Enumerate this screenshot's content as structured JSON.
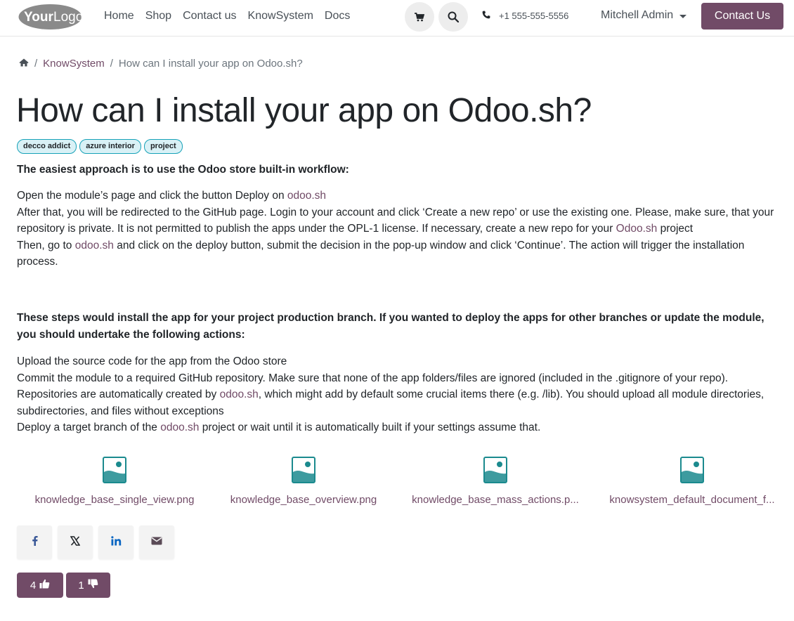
{
  "header": {
    "logo_text": "YourLogo",
    "nav": [
      "Home",
      "Shop",
      "Contact us",
      "KnowSystem",
      "Docs"
    ],
    "phone": "+1 555-555-5556",
    "user": "Mitchell Admin",
    "contact_button": "Contact Us",
    "icons": {
      "cart": "cart-icon",
      "search": "search-icon",
      "phone": "phone-icon"
    }
  },
  "breadcrumb": {
    "home_icon": "home-icon",
    "section": "KnowSystem",
    "current": "How can I install your app on Odoo.sh?"
  },
  "article": {
    "title": "How can I install your app on Odoo.sh?",
    "tags": [
      "decco addict",
      "azure interior",
      "project"
    ],
    "lead1": "The easiest approach is to use the Odoo store built-in workflow:",
    "p1_line1_text": "Open the module’s page and click the button Deploy on ",
    "p1_line1_link": "odoo.sh",
    "p1_line2_text": "After that, you will be redirected to the GitHub page. Login to your account and click ‘Create a new repo’ or use the existing one. Please, make sure, that your repository is private. It is not permitted to publish the apps under the OPL-1 license. If necessary, create a new repo for your ",
    "p1_line2_link": "Odoo.sh",
    "p1_line2_tail": " project",
    "p1_line3_text": "Then, go to ",
    "p1_line3_link": "odoo.sh",
    "p1_line3_tail": " and click on the deploy button, submit the decision in the pop-up window and click ‘Continue’. The action will trigger the installation process.",
    "lead2": "These steps would install the app for your project production branch. If you wanted to deploy the apps for other branches or update the module, you should undertake the following actions:",
    "p2_line1_text": "Upload the source code for the app from the Odoo store",
    "p2_line2_text": "Commit the module to a required GitHub repository. Make sure that none of the app folders/files are ignored (included in the .gitignore of your repo). Repositories are automatically created by ",
    "p2_line2_link": "odoo.sh",
    "p2_line2_tail": ", which might add by default some crucial items there (e.g. /lib). You should upload all module directories, subdirectories, and files without exceptions",
    "p2_line3_text": "Deploy a target branch of the ",
    "p2_line3_link": "odoo.sh",
    "p2_line3_tail": " project or wait until it is automatically built if your settings assume that."
  },
  "attachments": [
    {
      "name": "knowledge_base_single_view.png",
      "icon": "image-file-icon"
    },
    {
      "name": "knowledge_base_overview.png",
      "icon": "image-file-icon"
    },
    {
      "name": "knowledge_base_mass_actions.p...",
      "icon": "image-file-icon"
    },
    {
      "name": "knowsystem_default_document_f...",
      "icon": "image-file-icon"
    }
  ],
  "share": {
    "icons": [
      "facebook-icon",
      "x-icon",
      "linkedin-icon",
      "email-icon"
    ]
  },
  "votes": {
    "likes": "4",
    "dislikes": "1"
  },
  "colors": {
    "brand": "#714b67",
    "tag_bg": "#d9f1f6",
    "tag_border": "#17a2b8",
    "attachment_icon": "#1b8a8e"
  }
}
